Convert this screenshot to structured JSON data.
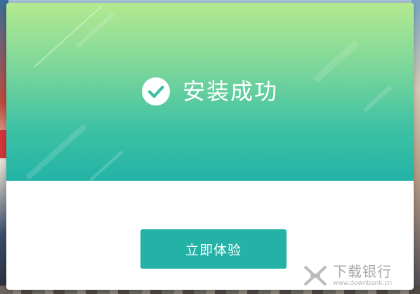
{
  "dialog": {
    "status_text": "安装成功",
    "status_icon": "check-circle-icon",
    "primary_button_label": "立即体验"
  },
  "watermark": {
    "name": "下载银行",
    "url": "www.downbank.cn"
  },
  "colors": {
    "header_top": "#b3ea8f",
    "header_bottom": "#22b3a6",
    "button": "#23b2a5",
    "text_on_accent": "#ffffff"
  }
}
